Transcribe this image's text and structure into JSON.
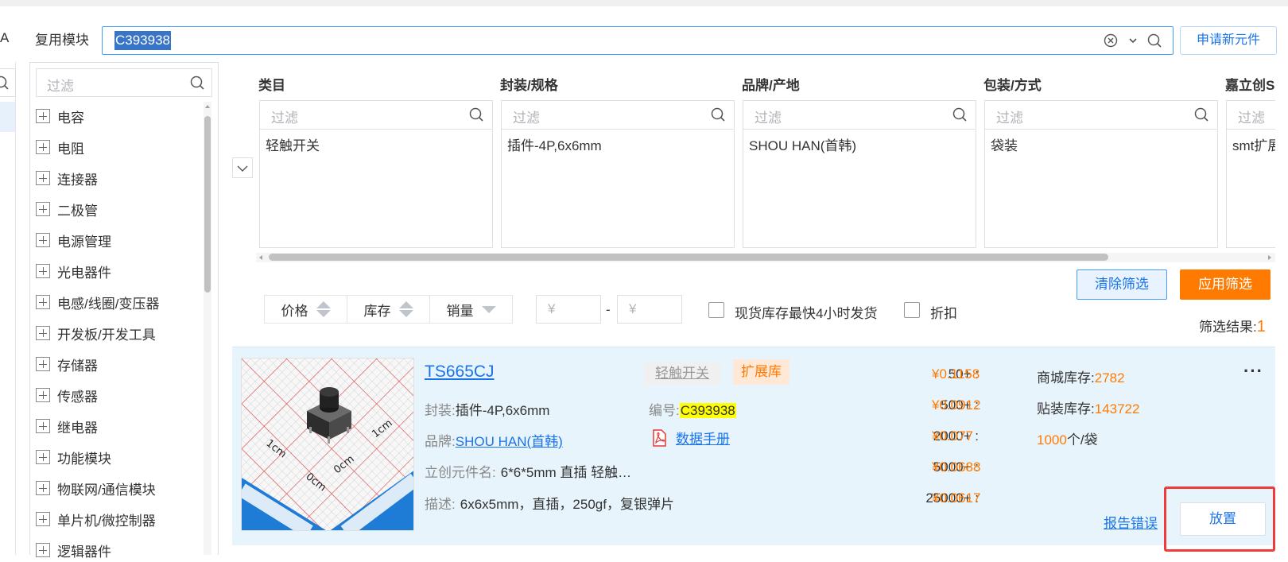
{
  "top": {
    "left_tab": "A",
    "reuse_tab": "复用模块",
    "search_value": "C393938",
    "apply_new_label": "申请新元件"
  },
  "tree": {
    "filter_placeholder": "过滤",
    "items": [
      "电容",
      "电阻",
      "连接器",
      "二极管",
      "电源管理",
      "光电器件",
      "电感/线圈/变压器",
      "开发板/开发工具",
      "存储器",
      "传感器",
      "继电器",
      "功能模块",
      "物联网/通信模块",
      "单片机/微控制器",
      "逻辑器件"
    ]
  },
  "filters": {
    "placeholder": "过滤",
    "columns": [
      {
        "title": "类目",
        "value": "轻触开关"
      },
      {
        "title": "封装/规格",
        "value": "插件-4P,6x6mm"
      },
      {
        "title": "品牌/产地",
        "value": "SHOU HAN(首韩)"
      },
      {
        "title": "包装/方式",
        "value": "袋装"
      },
      {
        "title": "嘉立创S",
        "value": "smt扩展"
      }
    ],
    "clear_label": "清除筛选",
    "apply_label": "应用筛选"
  },
  "sort": {
    "price": "价格",
    "stock": "库存",
    "sales": "销量",
    "min_placeholder": "¥",
    "max_placeholder": "¥",
    "dash": "-",
    "instock_label": "现货库存最快4小时发货",
    "discount_label": "折扣",
    "result_label": "筛选结果:",
    "result_count": "1"
  },
  "product": {
    "title": "TS665CJ",
    "tag_category": "轻触开关",
    "tag_library": "扩展库",
    "package_label": "封装:",
    "package_value": "插件-4P,6x6mm",
    "code_label": "编号:",
    "code_value": "C393938",
    "brand_label": "品牌:",
    "brand_value": "SHOU HAN(首韩)",
    "datasheet_label": "数据手册",
    "lcsc_name_label": "立创元件名:",
    "lcsc_name_value": "6*6*5mm 直插 轻触…",
    "desc_label": "描述:",
    "desc_value": "6x6x5mm，直插，250gf，复银弹片",
    "tiers": [
      {
        "qty": "50+ :",
        "price": "¥0.1158"
      },
      {
        "qty": "500+ :",
        "price": "¥0.0912"
      },
      {
        "qty": "2000+ :",
        "price": "¥0.077"
      },
      {
        "qty": "5000+ :",
        "price": "¥0.0688"
      },
      {
        "qty": "25000+ :",
        "price": "¥0.0617"
      }
    ],
    "mall_stock_label": "商城库存:",
    "mall_stock_value": "2782",
    "smt_stock_label": "贴装库存:",
    "smt_stock_value": "143722",
    "pack_qty": "1000",
    "pack_unit": "个/袋",
    "more": "···",
    "report_label": "报告错误",
    "place_label": "放置"
  },
  "colors": {
    "accent": "#1a73e8",
    "orange": "#ff7a00",
    "card_bg": "#e8f4fc",
    "highlight_box": "#ee3b3b"
  }
}
